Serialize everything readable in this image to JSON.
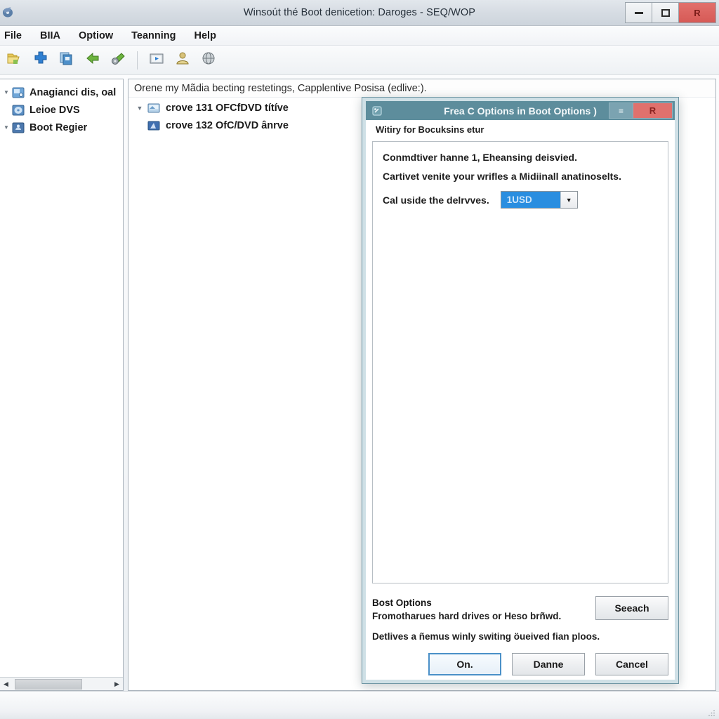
{
  "window": {
    "title": "Winsoút thé Boot denicetion: Daroges - SEQ/WOP",
    "icon": "app-disk-icon",
    "controls": {
      "minimize": "minimize-icon",
      "maximize": "maximize-icon",
      "close_label": "R"
    }
  },
  "menubar": {
    "items": [
      {
        "label": "File"
      },
      {
        "label": "BIIA"
      },
      {
        "label": "Optiow"
      },
      {
        "label": "Teanning"
      },
      {
        "label": "Help"
      }
    ]
  },
  "toolbar": {
    "buttons": [
      {
        "icon": "folder-open-icon"
      },
      {
        "icon": "add-plus-icon"
      },
      {
        "icon": "copy-disk-icon"
      },
      {
        "icon": "green-arrow-icon"
      },
      {
        "icon": "green-gear-icon"
      },
      {
        "icon": "play-media-icon"
      },
      {
        "icon": "user-icon"
      },
      {
        "icon": "globe-help-icon"
      }
    ]
  },
  "sidebar": {
    "items": [
      {
        "label": "Anagianci dis, oal",
        "icon": "disk-drive-icon",
        "expander": "collapsed"
      },
      {
        "label": "Leioe DVS",
        "icon": "dvd-icon",
        "expander": "none"
      },
      {
        "label": "Boot Regier",
        "icon": "boot-icon",
        "expander": "collapsed"
      }
    ],
    "scrollbar": {
      "left_arrow": "scroll-left-icon",
      "right_arrow": "scroll-right-icon"
    }
  },
  "main": {
    "header": "Orene my Mãdia becting restetings, Capplentive Posisa (edlive:).",
    "rows": [
      {
        "label": "crove 131 OFCfDVD títíve",
        "icon": "optical-drive-icon",
        "expander": "expanded"
      },
      {
        "label": "crove 132 OfC/DVD ânrve",
        "icon": "optical-drive-blue-icon",
        "expander": "none"
      }
    ]
  },
  "dialog": {
    "title": "Frea C Options in Boot Options )",
    "icon": "dialog-disk-icon",
    "controls": {
      "collapse_label": "≡",
      "close_label": "R"
    },
    "subtitle": "Witiry for Bocuksins etur",
    "lines": [
      "Conmdtiver hanne 1, Eheansing deisvied.",
      "Cartivet venite your wrifles a Midiinall anatinoselts."
    ],
    "field": {
      "label": "Cal uside the delrvves.",
      "value": "1USD",
      "arrow_icon": "chevron-down-icon"
    },
    "footer": {
      "heading": "Bost Options",
      "subtext": "Fromotharues hard drives or Heso brñwd.",
      "search_button": "Seeach",
      "note": "Detlives a ñemus winly switing öueived fian ploos."
    },
    "actions": [
      {
        "label": "On.",
        "default": true
      },
      {
        "label": "Danne",
        "default": false
      },
      {
        "label": "Cancel",
        "default": false
      }
    ]
  },
  "colors": {
    "dialog_titlebar": "#5d8d9c",
    "dialog_frame": "#cfe0e6",
    "close_red": "#e0716d",
    "combo_highlight": "#2a8ee0"
  }
}
